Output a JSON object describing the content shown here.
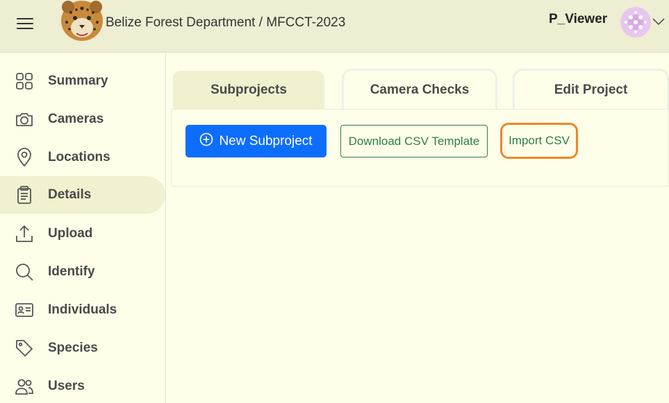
{
  "header": {
    "title": "Belize Forest Department / MFCCT-2023",
    "username": "P_Viewer"
  },
  "sidebar": {
    "items": [
      {
        "label": "Summary",
        "icon": "grid-icon"
      },
      {
        "label": "Cameras",
        "icon": "camera-icon"
      },
      {
        "label": "Locations",
        "icon": "map-pin-icon"
      },
      {
        "label": "Details",
        "icon": "clipboard-icon",
        "active": true
      },
      {
        "label": "Upload",
        "icon": "upload-icon"
      },
      {
        "label": "Identify",
        "icon": "search-icon"
      },
      {
        "label": "Individuals",
        "icon": "id-card-icon"
      },
      {
        "label": "Species",
        "icon": "tag-icon"
      },
      {
        "label": "Users",
        "icon": "users-icon"
      }
    ]
  },
  "tabs": [
    {
      "label": "Subprojects",
      "active": true
    },
    {
      "label": "Camera Checks"
    },
    {
      "label": "Edit Project"
    }
  ],
  "actions": {
    "new_subproject": "New Subproject",
    "download_template": "Download CSV Template",
    "import_csv": "Import CSV"
  },
  "colors": {
    "primary": "#0d6efd",
    "outline_green": "#2e7d4a",
    "highlight": "#f28427",
    "header_bg": "#eeeed3",
    "page_bg": "#fefee9"
  }
}
